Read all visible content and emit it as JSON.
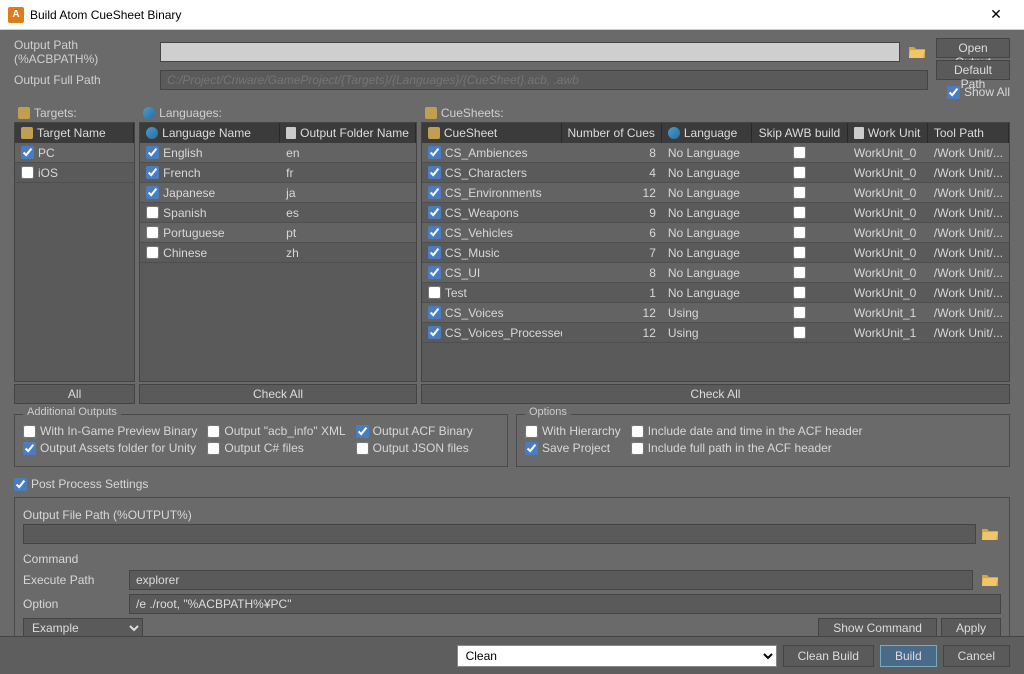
{
  "window": {
    "title": "Build Atom CueSheet Binary",
    "close": "✕"
  },
  "paths": {
    "output_label": "Output Path (%ACBPATH%)",
    "output_value": "",
    "fullpath_label": "Output Full Path",
    "fullpath_placeholder": "C:/Project/Criware/GameProject/{Targets}/{Languages}/{CueSheet}.acb, .awb"
  },
  "buttons": {
    "open_output": "Open Output",
    "default_path": "Default Path",
    "show_all": "Show All",
    "all": "All",
    "check_all": "Check All",
    "show_command": "Show Command",
    "apply": "Apply",
    "clean_build": "Clean Build",
    "build": "Build",
    "cancel": "Cancel"
  },
  "targets": {
    "title": "Targets:",
    "header": "Target Name",
    "rows": [
      {
        "checked": true,
        "name": "PC"
      },
      {
        "checked": false,
        "name": "iOS"
      }
    ]
  },
  "languages": {
    "title": "Languages:",
    "header_name": "Language Name",
    "header_folder": "Output Folder Name",
    "rows": [
      {
        "checked": true,
        "name": "English",
        "folder": "en"
      },
      {
        "checked": true,
        "name": "French",
        "folder": "fr"
      },
      {
        "checked": true,
        "name": "Japanese",
        "folder": "ja"
      },
      {
        "checked": false,
        "name": "Spanish",
        "folder": "es"
      },
      {
        "checked": false,
        "name": "Portuguese",
        "folder": "pt"
      },
      {
        "checked": false,
        "name": "Chinese",
        "folder": "zh"
      }
    ]
  },
  "cuesheets": {
    "title": "CueSheets:",
    "headers": {
      "name": "CueSheet",
      "count": "Number of Cues",
      "lang": "Language",
      "skip": "Skip AWB build",
      "unit": "Work Unit",
      "tool": "Tool Path"
    },
    "rows": [
      {
        "checked": true,
        "name": "CS_Ambiences",
        "count": 8,
        "lang": "No Language",
        "skip": false,
        "unit": "WorkUnit_0",
        "tool": "/Work Unit/..."
      },
      {
        "checked": true,
        "name": "CS_Characters",
        "count": 4,
        "lang": "No Language",
        "skip": false,
        "unit": "WorkUnit_0",
        "tool": "/Work Unit/..."
      },
      {
        "checked": true,
        "name": "CS_Environments",
        "count": 12,
        "lang": "No Language",
        "skip": false,
        "unit": "WorkUnit_0",
        "tool": "/Work Unit/..."
      },
      {
        "checked": true,
        "name": "CS_Weapons",
        "count": 9,
        "lang": "No Language",
        "skip": false,
        "unit": "WorkUnit_0",
        "tool": "/Work Unit/..."
      },
      {
        "checked": true,
        "name": "CS_Vehicles",
        "count": 6,
        "lang": "No Language",
        "skip": false,
        "unit": "WorkUnit_0",
        "tool": "/Work Unit/..."
      },
      {
        "checked": true,
        "name": "CS_Music",
        "count": 7,
        "lang": "No Language",
        "skip": false,
        "unit": "WorkUnit_0",
        "tool": "/Work Unit/..."
      },
      {
        "checked": true,
        "name": "CS_UI",
        "count": 8,
        "lang": "No Language",
        "skip": false,
        "unit": "WorkUnit_0",
        "tool": "/Work Unit/..."
      },
      {
        "checked": false,
        "name": "Test",
        "count": 1,
        "lang": "No Language",
        "skip": false,
        "unit": "WorkUnit_0",
        "tool": "/Work Unit/..."
      },
      {
        "checked": true,
        "name": "CS_Voices",
        "count": 12,
        "lang": "Using",
        "skip": false,
        "unit": "WorkUnit_1",
        "tool": "/Work Unit/..."
      },
      {
        "checked": true,
        "name": "CS_Voices_Processed",
        "count": 12,
        "lang": "Using",
        "skip": false,
        "unit": "WorkUnit_1",
        "tool": "/Work Unit/..."
      }
    ]
  },
  "additional": {
    "title": "Additional Outputs",
    "ingame": "With In-Game Preview Binary",
    "acbinfo": "Output \"acb_info\" XML",
    "acf": "Output ACF Binary",
    "unity": "Output Assets folder for Unity",
    "csharp": "Output C# files",
    "json": "Output JSON files"
  },
  "options": {
    "title": "Options",
    "hierarchy": "With Hierarchy",
    "datetime": "Include date and time in the ACF header",
    "save": "Save Project",
    "fullpath": "Include full path in the ACF header"
  },
  "postprocess": {
    "toggle": "Post Process Settings",
    "file_label": "Output File Path (%OUTPUT%)",
    "file_value": "",
    "command_label": "Command",
    "exec_label": "Execute Path",
    "exec_value": "explorer",
    "option_label": "Option",
    "option_value": "/e ./root, \"%ACBPATH%¥PC\"",
    "example": "Example"
  },
  "bottom": {
    "clean_option": "Clean"
  }
}
